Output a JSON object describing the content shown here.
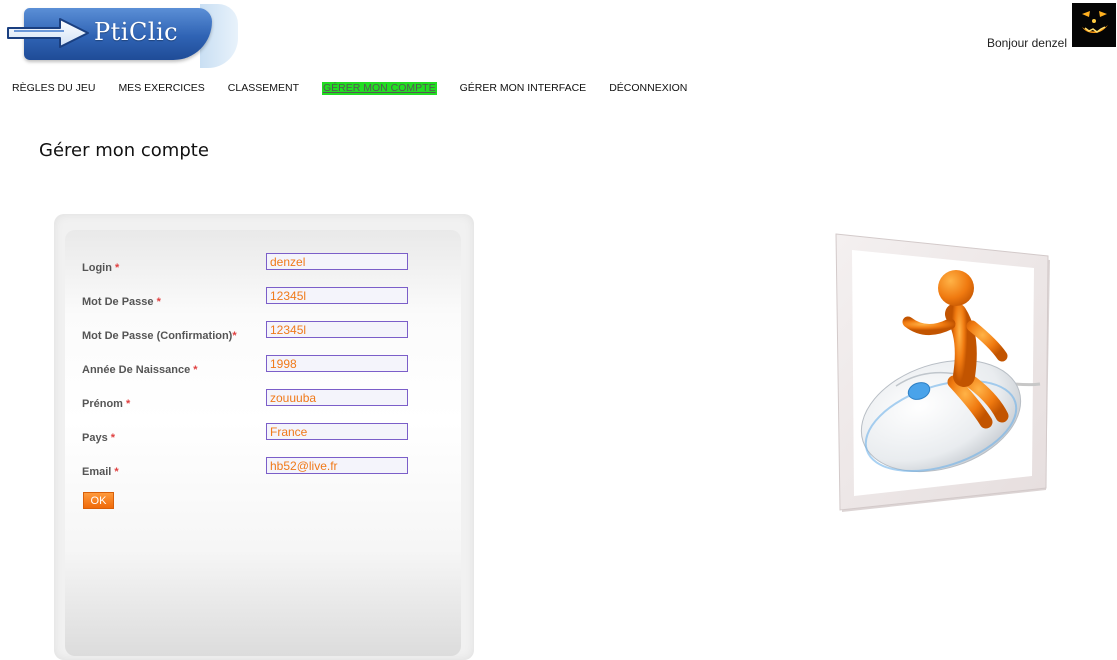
{
  "brand": {
    "logo_text": "PtiClic",
    "logo_icon": "arrow-icon"
  },
  "header": {
    "greeting": "Bonjour denzel",
    "avatar_icon": "pumpkin-avatar"
  },
  "nav": {
    "items": [
      {
        "label": "RÈGLES DU JEU",
        "active": false
      },
      {
        "label": "MES EXERCICES",
        "active": false
      },
      {
        "label": "CLASSEMENT",
        "active": false
      },
      {
        "label": "GÉRER MON COMPTE",
        "active": true
      },
      {
        "label": "GÉRER MON INTERFACE",
        "active": false
      },
      {
        "label": "DÉCONNEXION",
        "active": false
      }
    ],
    "active_color": "#22dd22"
  },
  "page": {
    "title": "Gérer mon compte"
  },
  "form": {
    "required_mark": "*",
    "fields": [
      {
        "label": "Login",
        "value": "denzel"
      },
      {
        "label": "Mot De Passe",
        "value": "12345l"
      },
      {
        "label": "Mot De Passe (Confirmation)",
        "value": "12345l"
      },
      {
        "label": "Année De Naissance",
        "value": "1998"
      },
      {
        "label": "Prénom",
        "value": "zouuuba"
      },
      {
        "label": "Pays",
        "value": "France"
      },
      {
        "label": "Email",
        "value": "hb52@live.fr"
      }
    ],
    "submit_label": "OK",
    "accent": "#f07a1a",
    "input_border": "#7b5ec9"
  },
  "illustration": {
    "icon": "figure-on-mouse-illustration"
  }
}
